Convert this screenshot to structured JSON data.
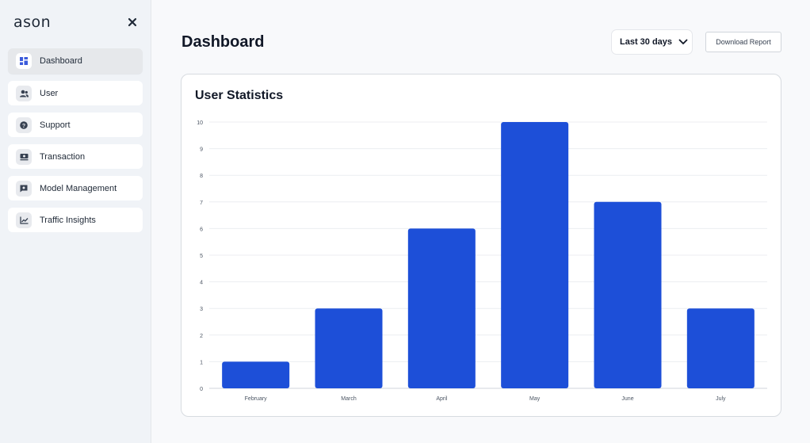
{
  "sidebar": {
    "logo": "ason",
    "items": [
      {
        "label": "Dashboard",
        "icon": "dashboard-icon",
        "active": true
      },
      {
        "label": "User",
        "icon": "user-icon"
      },
      {
        "label": "Support",
        "icon": "support-icon"
      },
      {
        "label": "Transaction",
        "icon": "transaction-icon"
      },
      {
        "label": "Model Management",
        "icon": "model-management-icon"
      },
      {
        "label": "Traffic Insights",
        "icon": "traffic-insights-icon"
      }
    ]
  },
  "header": {
    "title": "Dashboard",
    "range_label": "Last 30 days",
    "download_label": "Download Report"
  },
  "card": {
    "title": "User Statistics"
  },
  "colors": {
    "bar": "#1d4fd8",
    "accent_icon": "#3b5bdb"
  },
  "chart_data": {
    "type": "bar",
    "title": "User Statistics",
    "categories": [
      "February",
      "March",
      "April",
      "May",
      "June",
      "July"
    ],
    "values": [
      1,
      3,
      6,
      10,
      7,
      3
    ],
    "xlabel": "",
    "ylabel": "",
    "ylim": [
      0,
      10
    ],
    "yticks": [
      0,
      1,
      2,
      3,
      4,
      5,
      6,
      7,
      8,
      9,
      10
    ],
    "grid": true,
    "legend": "none"
  }
}
